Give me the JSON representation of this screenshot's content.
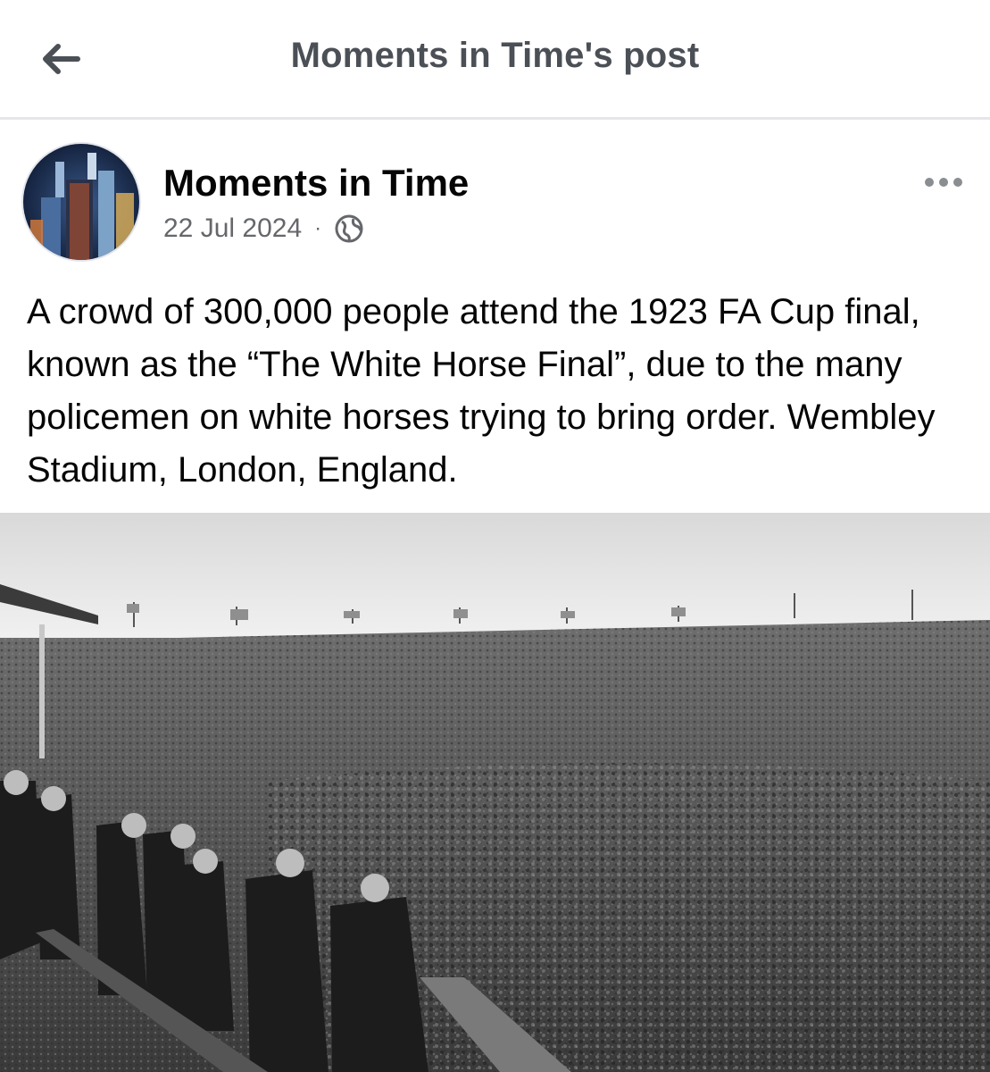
{
  "topbar": {
    "back_icon": "arrow-left-icon",
    "title": "Moments in Time's post"
  },
  "post": {
    "author": "Moments in Time",
    "date": "22 Jul 2024",
    "separator": "·",
    "privacy_icon": "globe-icon",
    "more_icon": "more-horizontal-icon",
    "text": "A crowd of 300,000 people attend the 1923 FA Cup final, known as the “The White Horse Final”, due to the many policemen on white horses trying to bring order. Wembley Stadium, London, England."
  },
  "colors": {
    "title_gray": "#4b4f56",
    "meta_gray": "#65676b",
    "divider": "#e4e6eb"
  }
}
